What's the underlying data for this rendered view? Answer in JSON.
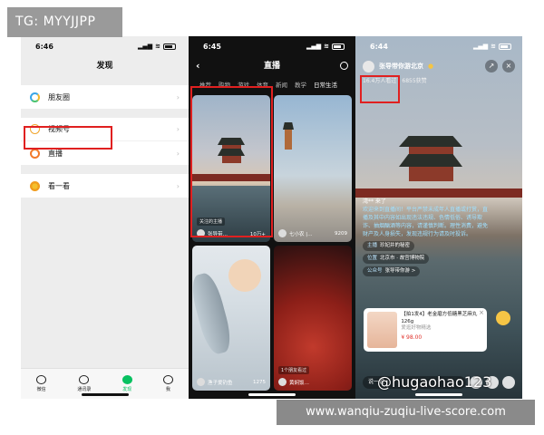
{
  "watermark": {
    "tag": "TG: MYYJJPP",
    "site": "www.wanqiu-zuqiu-live-score.com",
    "handle": "@hugaohao123"
  },
  "phone1": {
    "time": "6:46",
    "title": "发现",
    "rows": [
      {
        "label": "朋友圈",
        "icon": "moments-icon"
      },
      {
        "label": "视频号",
        "icon": "channels-icon"
      },
      {
        "label": "直播",
        "icon": "live-icon"
      },
      {
        "label": "看一看",
        "icon": "look-icon"
      }
    ],
    "tabs": [
      "微信",
      "通讯录",
      "发现",
      "我"
    ]
  },
  "phone2": {
    "time": "6:45",
    "title": "直播",
    "categories": [
      "推荐",
      "购物",
      "游戏",
      "体育",
      "新闻",
      "教学",
      "日常生活"
    ],
    "cards": [
      {
        "name": "张导带…",
        "count": "10万+",
        "badge": "关注的主播"
      },
      {
        "name": "七小农 |…",
        "count": "9209"
      },
      {
        "name": "渔子爱钓鱼",
        "count": "1275"
      },
      {
        "name": "黄焖饭…",
        "count": "",
        "badge": "1个朋友看过"
      }
    ]
  },
  "phone3": {
    "time": "6:44",
    "host": "张导带你游北京",
    "viewers": "16.4万人看过",
    "likes": "6855获赞",
    "join_msg": "湾** 来了",
    "notice": "欢迎来到直播间！平台严禁未成年人直播或打赏，直播及其中内容如出现违法违规、色情低俗、诱导欺诈、抽烟酗酒等内容，请谨慎判断。理性消费，避免财产及人身损失，发现违规行为请及时投诉。",
    "chips": [
      {
        "key": "主播",
        "val": "珍妃井的秘密"
      },
      {
        "key": "位置",
        "val": "北京市 · 故宫博物院"
      },
      {
        "key": "公众号",
        "val": "张导带你游 >"
      }
    ],
    "product": {
      "title": "【拍1发4】老金磨方低糖黑芝麻丸126g",
      "shop": "爱逛好物精选",
      "price": "¥ 98.00"
    },
    "say": "说一说"
  }
}
